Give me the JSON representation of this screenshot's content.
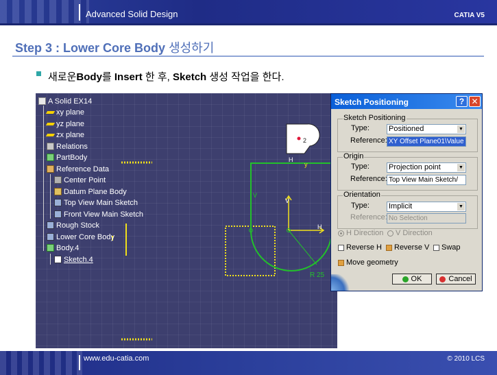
{
  "header": {
    "course_title": "Advanced Solid Design",
    "brand": "CATIA V5"
  },
  "step": {
    "title_en": "Step 3 : Lower Core Body",
    "title_kr": "생성하기"
  },
  "bullet": {
    "part1": "새로운",
    "part2": "Body",
    "part3": "를 ",
    "part4": "Insert",
    "part5": " 한 후, ",
    "part6": "Sketch",
    "part7": " 생성 작업을 한다."
  },
  "tree": {
    "items": [
      {
        "label": "A Solid EX14",
        "icon": "part-icon",
        "underlined": false
      },
      {
        "label": "xy plane",
        "icon": "plane-icon",
        "underlined": false
      },
      {
        "label": "yz plane",
        "icon": "plane-icon",
        "underlined": false
      },
      {
        "label": "zx plane",
        "icon": "plane-icon",
        "underlined": false
      },
      {
        "label": "Relations",
        "icon": "relations-icon",
        "underlined": false
      },
      {
        "label": "PartBody",
        "icon": "partbody-icon",
        "underlined": false
      },
      {
        "label": "Reference Data",
        "icon": "geoset-icon",
        "underlined": false
      },
      {
        "label": "Center Point",
        "icon": "point-icon",
        "underlined": false
      },
      {
        "label": "Datum Plane Body",
        "icon": "body-icon",
        "underlined": false
      },
      {
        "label": "Top View Main Sketch",
        "icon": "sketch-icon",
        "underlined": false
      },
      {
        "label": "Front View Main Sketch",
        "icon": "sketch-icon",
        "underlined": false
      },
      {
        "label": "Rough Stock",
        "icon": "body-icon",
        "underlined": false
      },
      {
        "label": "Lower Core Body",
        "icon": "body-icon",
        "underlined": false
      },
      {
        "label": "Body.4",
        "icon": "body-icon",
        "underlined": false
      },
      {
        "label": "Sketch.4",
        "icon": "sketch-icon",
        "underlined": true
      }
    ]
  },
  "sketch_labels": {
    "h_top": "H",
    "v_top": "V",
    "point_2": "2",
    "h_right": "H",
    "v_left": "V",
    "v_center": "V",
    "radius": "R 25",
    "y_axis": "y"
  },
  "dialog": {
    "title": "Sketch Positioning",
    "help_glyph": "?",
    "close_glyph": "✕",
    "group_positioning": {
      "label": "Sketch Positioning",
      "type_label": "Type:",
      "type_value": "Positioned",
      "reference_label": "Reference:",
      "reference_value": "XY Offset Plane01\\Value"
    },
    "group_origin": {
      "label": "Origin",
      "type_label": "Type:",
      "type_value": "Projection point",
      "reference_label": "Reference:",
      "reference_value": "Top View Main Sketch/"
    },
    "group_orientation": {
      "label": "Orientation",
      "type_label": "Type:",
      "type_value": "Implicit",
      "reference_label": "Reference:",
      "reference_value": "No Selection"
    },
    "h_direction": "H Direction",
    "v_direction": "V Direction",
    "reverse_h": "Reverse H",
    "reverse_v": "Reverse V",
    "swap": "Swap",
    "move_geometry": "Move geometry",
    "ok_label": "OK",
    "cancel_label": "Cancel"
  },
  "footer": {
    "url": "www.edu-catia.com",
    "copyright": "© 2010 LCS"
  },
  "colors": {
    "accent_blue": "#4f6fb8",
    "viewport_bg": "#3d3f6e",
    "sketch_green": "#22c12a",
    "sketch_yellow": "#f2e11a",
    "dialog_title": "#0a5fd8"
  }
}
